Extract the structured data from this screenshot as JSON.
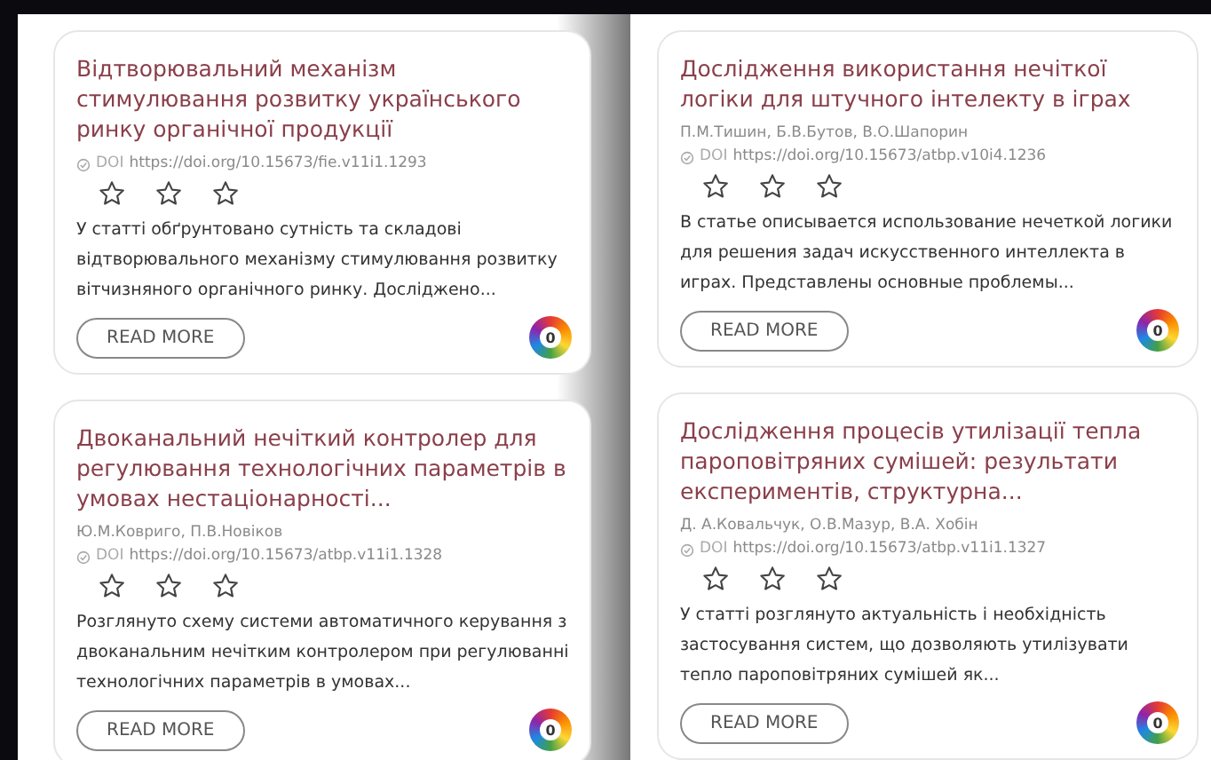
{
  "columns": [
    {
      "cards": [
        {
          "title": "Відтворювальний механізм стимулювання розвитку українського ринку органічної продукції",
          "doi_label": "DOI",
          "doi": "https://doi.org/10.15673/fie.v11i1.1293",
          "stars": 0,
          "abstract": "У статті обґрунтовано сутність та складові відтворювального механізму стимулювання розвитку вітчизняного органічного ринку. Досліджено...",
          "button": "READ MORE",
          "badge": "0"
        },
        {
          "title": "Двоканальний нечіткий контролер для регулювання технологічних параметрів в умовах нестаціонарності...",
          "authors": "Ю.М.Ковриго, П.В.Новіков",
          "doi_label": "DOI",
          "doi": "https://doi.org/10.15673/atbp.v11i1.1328",
          "stars": 0,
          "abstract": "Розглянуто схему системи автоматичного керування з двоканальним нечітким контролером при регулюванні технологічних параметрів в умовах...",
          "button": "READ MORE",
          "badge": "0"
        }
      ]
    },
    {
      "cards": [
        {
          "title": "Дослідження використання нечіткої логіки для штучного інтелекту в іграх",
          "authors": "П.М.Тишин, Б.В.Бутов, В.О.Шапорин",
          "doi_label": "DOI",
          "doi": "https://doi.org/10.15673/atbp.v10i4.1236",
          "stars": 0,
          "abstract": "В статье описывается использование нечеткой логики для решения задач искусственного интеллекта в играх. Представлены основные проблемы...",
          "button": "READ MORE",
          "badge": "0"
        },
        {
          "title": "Дослідження процесів утилізації тепла пароповітряних сумішей: результати експериментів, структурна...",
          "authors": "Д. А.Ковальчук, О.В.Мазур, В.А. Хобін",
          "doi_label": "DOI",
          "doi": "https://doi.org/10.15673/atbp.v11i1.1327",
          "stars": 0,
          "abstract": "У статті розглянуто актуальність і необхідність застосування систем, що дозволяють утилізувати тепло пароповітряних сумішей як...",
          "button": "READ MORE",
          "badge": "0"
        }
      ]
    }
  ]
}
